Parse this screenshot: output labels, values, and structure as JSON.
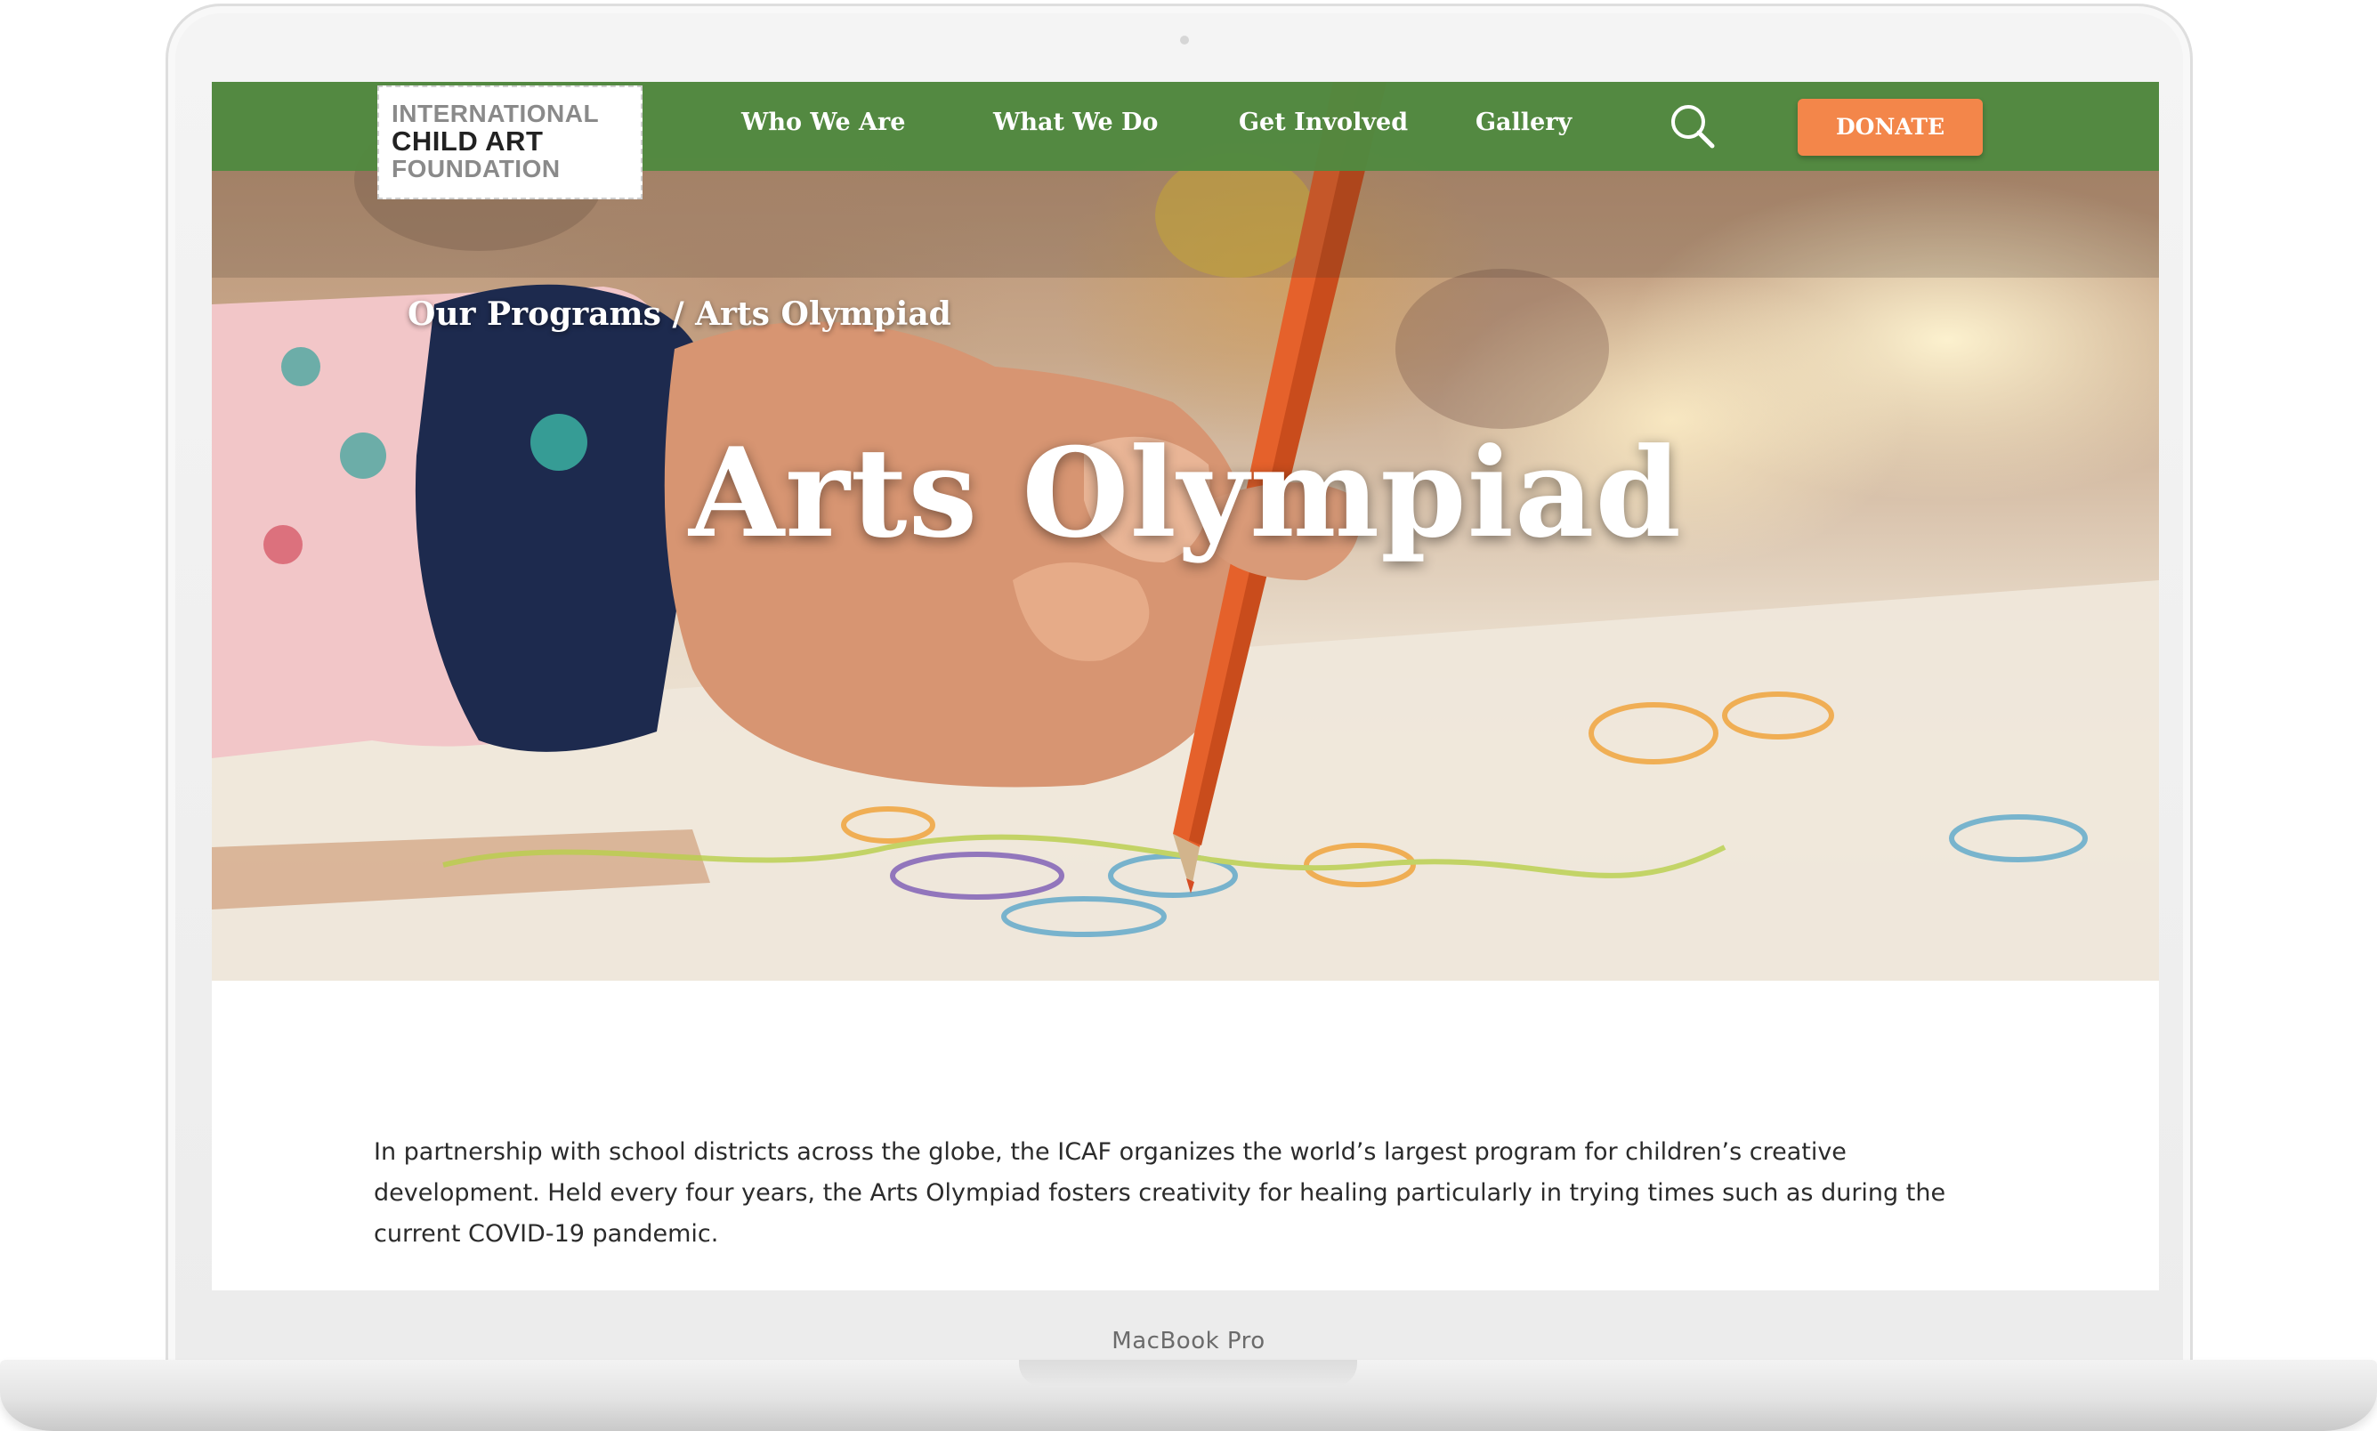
{
  "device": {
    "label": "MacBook Pro"
  },
  "brand": {
    "logo_lines": [
      "INTERNATIONAL",
      "CHILD ART",
      "FOUNDATION"
    ],
    "nav_color": "#508940",
    "accent_color": "#f3864a"
  },
  "nav": {
    "items": [
      {
        "label": "Who We Are"
      },
      {
        "label": "What We Do"
      },
      {
        "label": "Get Involved"
      },
      {
        "label": "Gallery"
      }
    ],
    "search_icon": "search-icon",
    "donate_label": "DONATE"
  },
  "hero": {
    "breadcrumb_parent": "Our Programs",
    "breadcrumb_separator": " / ",
    "breadcrumb_current": "Arts Olympiad",
    "title": "Arts Olympiad"
  },
  "intro": {
    "text": "In partnership with school districts across the globe, the ICAF organizes the world’s largest program for children’s creative development.  Held every four years, the Arts Olympiad fosters creativity for healing particularly in trying times such as during the current COVID-19 pandemic."
  }
}
